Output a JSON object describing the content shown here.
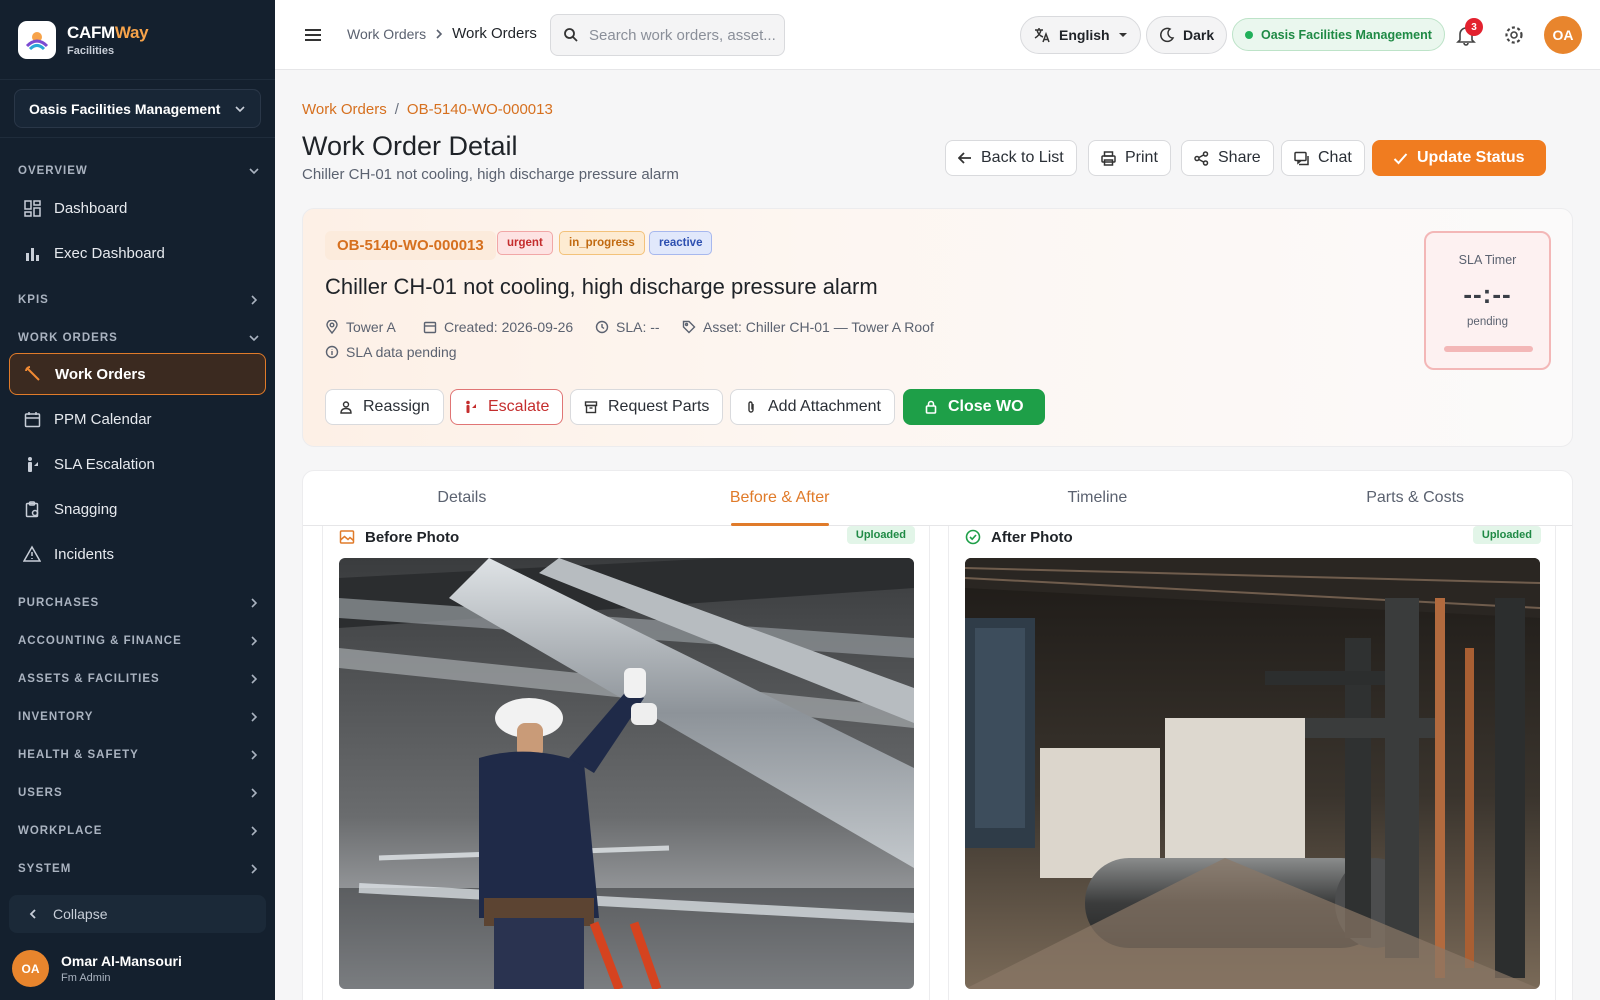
{
  "brand": {
    "name_main": "CAFM",
    "name_accent": "Way",
    "sub": "Facilities"
  },
  "org_selector": {
    "value": "Oasis Facilities Management"
  },
  "sidebar": {
    "overview_label": "OVERVIEW",
    "dashboard": "Dashboard",
    "exec_dashboard": "Exec Dashboard",
    "kpis_label": "KPIS",
    "work_orders_label": "WORK ORDERS",
    "work_orders": "Work Orders",
    "ppm_calendar": "PPM Calendar",
    "sla_escalation": "SLA Escalation",
    "snagging": "Snagging",
    "incidents": "Incidents",
    "purchases": "PURCHASES",
    "accounting": "ACCOUNTING & FINANCE",
    "assets": "ASSETS & FACILITIES",
    "inventory": "INVENTORY",
    "health": "HEALTH & SAFETY",
    "users": "USERS",
    "workplace": "WORKPLACE",
    "system": "SYSTEM",
    "collapse": "Collapse"
  },
  "user": {
    "initials": "OA",
    "name": "Omar Al-Mansouri",
    "role": "Fm Admin"
  },
  "topbar": {
    "crumb_parent": "Work Orders",
    "crumb_current": "Work Orders",
    "search_placeholder": "Search work orders, asset...",
    "language": "English",
    "theme": "Dark",
    "org": "Oasis Facilities Management",
    "notifications": "3",
    "avatar": "OA"
  },
  "page": {
    "breadcrumb_root": "Work Orders",
    "breadcrumb_sep": "/",
    "breadcrumb_id": "OB-5140-WO-000013",
    "title": "Work Order Detail",
    "subtitle": "Chiller CH-01 not cooling, high discharge pressure alarm",
    "buttons": {
      "back": "Back to List",
      "print": "Print",
      "share": "Share",
      "chat": "Chat",
      "update": "Update Status"
    }
  },
  "work_order": {
    "id": "OB-5140-WO-000013",
    "priority": "urgent",
    "status": "in_progress",
    "type": "reactive",
    "title": "Chiller CH-01 not cooling, high discharge pressure alarm",
    "location": "Tower A",
    "created": "Created: 2026-09-26",
    "sla": "SLA: --",
    "asset": "Asset: Chiller CH-01 — Tower A Roof",
    "sla_note": "SLA data pending",
    "actions": {
      "reassign": "Reassign",
      "escalate": "Escalate",
      "request_parts": "Request Parts",
      "add_attachment": "Add Attachment",
      "close": "Close WO"
    },
    "sla_timer": {
      "label": "SLA Timer",
      "value": "--:--",
      "state": "pending"
    }
  },
  "tabs": [
    "Details",
    "Before & After",
    "Timeline",
    "Parts & Costs"
  ],
  "active_tab": "Before & After",
  "photos": {
    "before": {
      "title": "Before Photo",
      "status": "Uploaded"
    },
    "after": {
      "title": "After Photo",
      "status": "Uploaded"
    }
  },
  "colors": {
    "accent": "#f07c20",
    "sidebar_bg": "#14202e",
    "success": "#1e9f48",
    "danger": "#c42d2d"
  }
}
